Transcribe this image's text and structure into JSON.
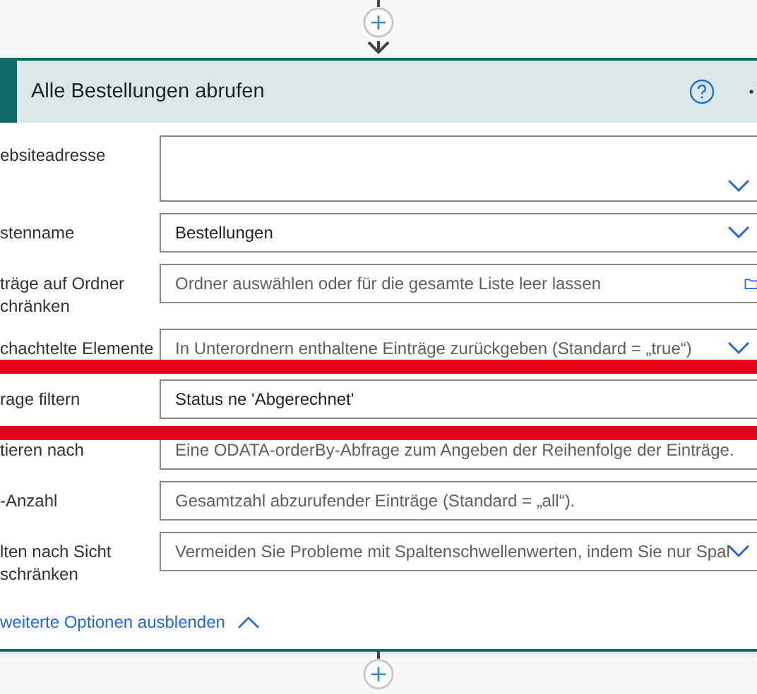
{
  "card": {
    "title": "Alle Bestellungen abrufen",
    "fields": [
      {
        "label": "ebsiteadresse",
        "kind": "combo"
      },
      {
        "label": "stenname",
        "kind": "dropdown",
        "value": "Bestellungen"
      },
      {
        "label": "träge auf Ordner\nchränken",
        "kind": "folder",
        "placeholder": "Ordner auswählen oder für die gesamte Liste leer lassen"
      },
      {
        "label": "chachtelte Elemente",
        "kind": "dropdown",
        "placeholder": "In Unterordnern enthaltene Einträge zurückgeben (Standard = „true“)",
        "struck_below": true
      },
      {
        "label": "rage filtern",
        "kind": "text",
        "value": "Status ne 'Abgerechnet'"
      },
      {
        "label": "tieren nach",
        "kind": "text",
        "placeholder": "Eine ODATA-orderBy-Abfrage zum Angeben der Reihenfolge der Einträge.",
        "struck_above": true
      },
      {
        "label": "-Anzahl",
        "kind": "text",
        "placeholder": "Gesamtzahl abzurufender Einträge (Standard = „all“)."
      },
      {
        "label": "lten nach Sicht\nschränken",
        "kind": "dropdown",
        "placeholder": "Vermeiden Sie Probleme mit Spaltenschwellenwerten, indem Sie nur Spal"
      }
    ],
    "toggle_link": {
      "label": "weiterte Optionen ausblenden",
      "expanded": true
    }
  }
}
